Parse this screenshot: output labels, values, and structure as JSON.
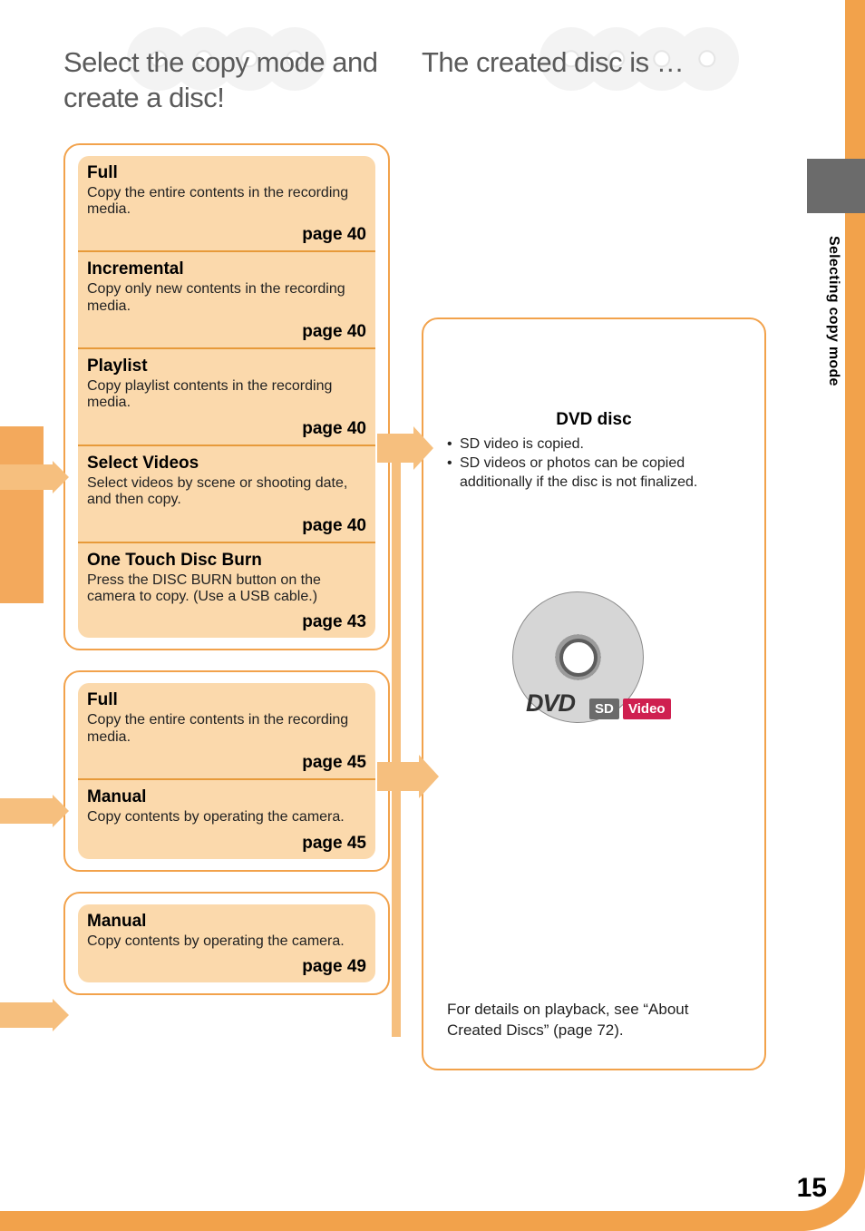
{
  "left_title": "Select the copy mode and create a disc!",
  "right_title": "The created disc is …",
  "side_label": "Selecting copy mode",
  "page_number": "15",
  "page_label_prefix": "page ",
  "groups": [
    {
      "items": [
        {
          "title": "Full",
          "desc": "Copy the entire contents in the recording media.",
          "page": "40"
        },
        {
          "title": "Incremental",
          "desc": "Copy only new contents in the recording media.",
          "page": "40"
        },
        {
          "title": "Playlist",
          "desc": "Copy playlist contents in the recording media.",
          "page": "40"
        },
        {
          "title": "Select Videos",
          "desc": "Select videos by scene or shooting date, and then copy.",
          "page": "40"
        },
        {
          "title": "One Touch Disc Burn",
          "desc": "Press the DISC BURN button on the camera to copy. (Use a USB cable.)",
          "page": "43"
        }
      ]
    },
    {
      "items": [
        {
          "title": "Full",
          "desc": "Copy the entire contents in the recording media.",
          "page": "45"
        },
        {
          "title": "Manual",
          "desc": "Copy contents by operating the camera.",
          "page": "45"
        }
      ]
    },
    {
      "items": [
        {
          "title": "Manual",
          "desc": "Copy contents by operating the camera.",
          "page": "49"
        }
      ]
    }
  ],
  "disc": {
    "heading": "DVD disc",
    "bullets": [
      "SD video is copied.",
      "SD videos or photos can be copied additionally if the disc is not finalized."
    ],
    "dvd_label": "DVD",
    "sd_tag": "SD",
    "video_tag": "Video",
    "footnote": "For details on playback, see “About Created Discs” (page 72)."
  }
}
